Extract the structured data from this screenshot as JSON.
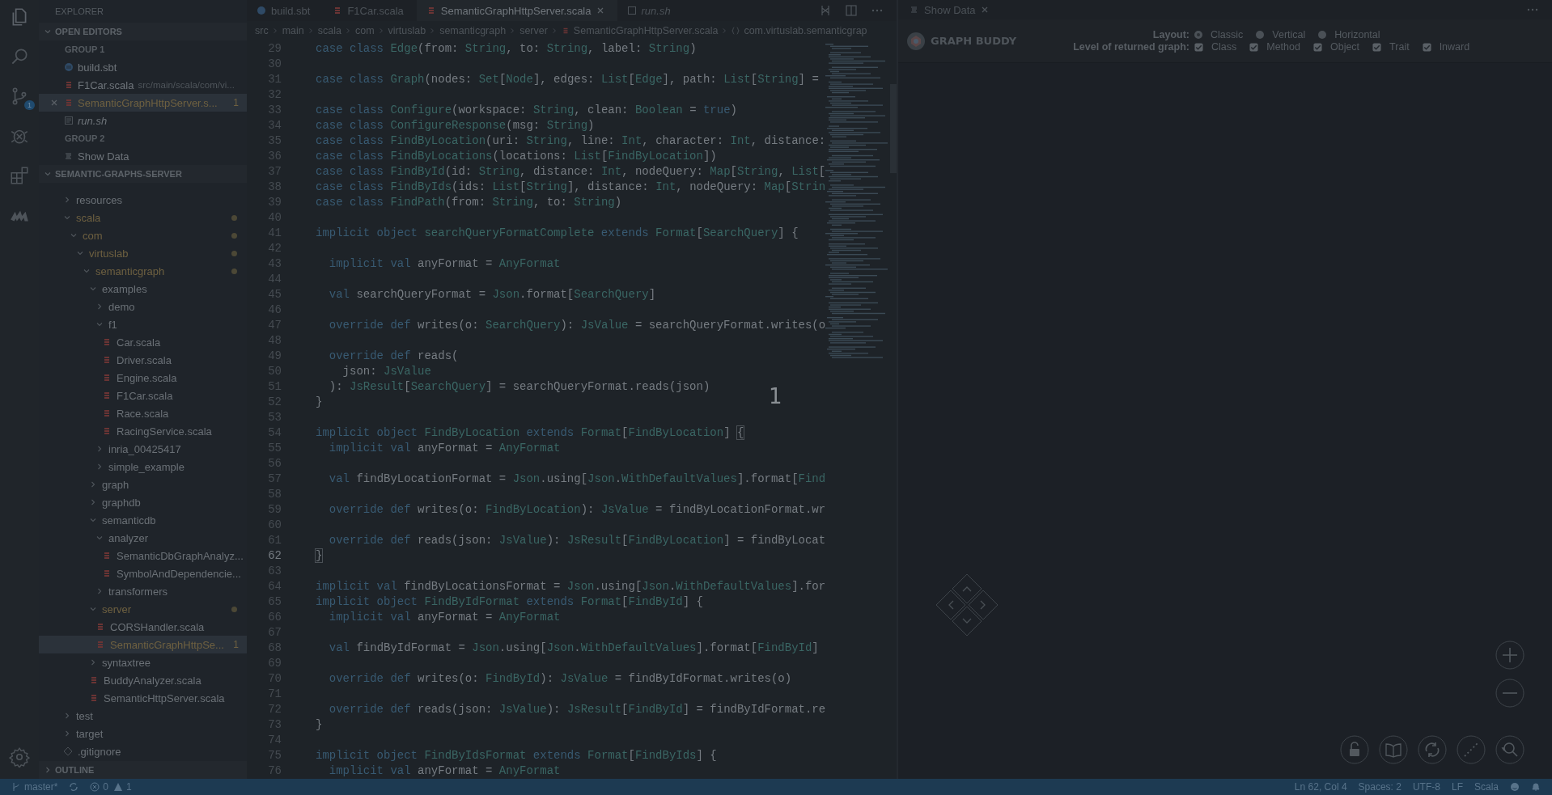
{
  "activity_bar": {
    "scm_badge": "1"
  },
  "sidebar": {
    "title": "EXPLORER",
    "open_editors": {
      "title": "OPEN EDITORS",
      "groups": [
        {
          "title": "GROUP 1",
          "items": [
            {
              "name": "build.sbt",
              "kind": "sbt",
              "selected": false,
              "italic": false,
              "modified": false
            },
            {
              "name": "F1Car.scala",
              "description": "src/main/scala/com/vi...",
              "kind": "scala",
              "selected": false,
              "italic": false,
              "modified": false
            },
            {
              "name": "SemanticGraphHttpServer.s...",
              "kind": "scala",
              "selected": true,
              "italic": false,
              "modified": true,
              "badge": "1"
            },
            {
              "name": "run.sh",
              "kind": "shell",
              "selected": false,
              "italic": true,
              "modified": false
            }
          ]
        },
        {
          "title": "GROUP 2",
          "items": [
            {
              "name": "Show Data",
              "kind": "preview",
              "selected": false,
              "italic": false,
              "modified": false
            }
          ]
        }
      ]
    },
    "folder": {
      "title": "SEMANTIC-GRAPHS-SERVER",
      "tree": [
        {
          "name": "resources",
          "kind": "folder",
          "expanded": false,
          "modified": false,
          "selected": false
        },
        {
          "name": "scala",
          "kind": "folder",
          "expanded": true,
          "modified": true,
          "selected": false,
          "children": [
            {
              "name": "com",
              "kind": "folder",
              "expanded": true,
              "modified": true,
              "selected": false,
              "children": [
                {
                  "name": "virtuslab",
                  "kind": "folder",
                  "expanded": true,
                  "modified": true,
                  "selected": false,
                  "children": [
                    {
                      "name": "semanticgraph",
                      "kind": "folder",
                      "expanded": true,
                      "modified": true,
                      "selected": false,
                      "children": [
                        {
                          "name": "examples",
                          "kind": "folder",
                          "expanded": true,
                          "modified": false,
                          "selected": false,
                          "children": [
                            {
                              "name": "demo",
                              "kind": "folder",
                              "expanded": false,
                              "modified": false,
                              "selected": false
                            },
                            {
                              "name": "f1",
                              "kind": "folder",
                              "expanded": true,
                              "modified": false,
                              "selected": false,
                              "children": [
                                {
                                  "name": "Car.scala",
                                  "kind": "scala",
                                  "modified": false,
                                  "selected": false
                                },
                                {
                                  "name": "Driver.scala",
                                  "kind": "scala",
                                  "modified": false,
                                  "selected": false
                                },
                                {
                                  "name": "Engine.scala",
                                  "kind": "scala",
                                  "modified": false,
                                  "selected": false
                                },
                                {
                                  "name": "F1Car.scala",
                                  "kind": "scala",
                                  "modified": false,
                                  "selected": false
                                },
                                {
                                  "name": "Race.scala",
                                  "kind": "scala",
                                  "modified": false,
                                  "selected": false
                                },
                                {
                                  "name": "RacingService.scala",
                                  "kind": "scala",
                                  "modified": false,
                                  "selected": false
                                }
                              ]
                            },
                            {
                              "name": "inria_00425417",
                              "kind": "folder",
                              "expanded": false,
                              "modified": false,
                              "selected": false
                            },
                            {
                              "name": "simple_example",
                              "kind": "folder",
                              "expanded": false,
                              "modified": false,
                              "selected": false
                            }
                          ]
                        },
                        {
                          "name": "graph",
                          "kind": "folder",
                          "expanded": false,
                          "modified": false,
                          "selected": false
                        },
                        {
                          "name": "graphdb",
                          "kind": "folder",
                          "expanded": false,
                          "modified": false,
                          "selected": false
                        },
                        {
                          "name": "semanticdb",
                          "kind": "folder",
                          "expanded": true,
                          "modified": false,
                          "selected": false,
                          "children": [
                            {
                              "name": "analyzer",
                              "kind": "folder",
                              "expanded": true,
                              "modified": false,
                              "selected": false,
                              "children": [
                                {
                                  "name": "SemanticDbGraphAnalyz...",
                                  "kind": "scala",
                                  "modified": false,
                                  "selected": false
                                },
                                {
                                  "name": "SymbolAndDependencie...",
                                  "kind": "scala",
                                  "modified": false,
                                  "selected": false
                                }
                              ]
                            },
                            {
                              "name": "transformers",
                              "kind": "folder",
                              "expanded": false,
                              "modified": false,
                              "selected": false
                            }
                          ]
                        },
                        {
                          "name": "server",
                          "kind": "folder",
                          "expanded": true,
                          "modified": true,
                          "selected": false,
                          "children": [
                            {
                              "name": "CORSHandler.scala",
                              "kind": "scala",
                              "modified": false,
                              "selected": false
                            },
                            {
                              "name": "SemanticGraphHttpSe...",
                              "kind": "scala",
                              "modified": true,
                              "selected": true,
                              "badge": "1"
                            }
                          ]
                        },
                        {
                          "name": "syntaxtree",
                          "kind": "folder",
                          "expanded": false,
                          "modified": false,
                          "selected": false
                        },
                        {
                          "name": "BuddyAnalyzer.scala",
                          "kind": "scala",
                          "modified": false,
                          "selected": false
                        },
                        {
                          "name": "SemanticHttpServer.scala",
                          "kind": "scala",
                          "modified": false,
                          "selected": false
                        }
                      ]
                    }
                  ]
                }
              ]
            }
          ]
        },
        {
          "name": "test",
          "kind": "folder",
          "expanded": false,
          "modified": false,
          "selected": false
        },
        {
          "name": "target",
          "kind": "folder",
          "expanded": false,
          "modified": false,
          "selected": false
        },
        {
          "name": ".gitignore",
          "kind": "git",
          "modified": false,
          "selected": false
        }
      ]
    },
    "outline": {
      "title": "OUTLINE"
    }
  },
  "editor": {
    "tabs": [
      {
        "label": "build.sbt",
        "kind": "sbt",
        "selected": false,
        "italic": false
      },
      {
        "label": "F1Car.scala",
        "kind": "scala",
        "selected": false,
        "italic": false
      },
      {
        "label": "SemanticGraphHttpServer.scala",
        "kind": "scala",
        "selected": true,
        "italic": false
      },
      {
        "label": "run.sh",
        "kind": "shell",
        "selected": false,
        "italic": true
      }
    ],
    "breadcrumbs": [
      {
        "label": "src",
        "kind": "folder"
      },
      {
        "label": "main",
        "kind": "folder"
      },
      {
        "label": "scala",
        "kind": "folder"
      },
      {
        "label": "com",
        "kind": "folder"
      },
      {
        "label": "virtuslab",
        "kind": "folder"
      },
      {
        "label": "semanticgraph",
        "kind": "folder"
      },
      {
        "label": "server",
        "kind": "folder"
      },
      {
        "label": "SemanticGraphHttpServer.scala",
        "kind": "file"
      },
      {
        "label": "com.virtuslab.semanticgrap",
        "kind": "package"
      }
    ],
    "lines": [
      {
        "n": "29",
        "tokens": [
          {
            "text": "case class ",
            "kind": "keyword"
          },
          {
            "text": "Edge",
            "kind": "type"
          },
          {
            "text": "(from: ",
            "kind": "plain"
          },
          {
            "text": "String",
            "kind": "type"
          },
          {
            "text": ", to: ",
            "kind": "plain"
          },
          {
            "text": "String",
            "kind": "type"
          },
          {
            "text": ", label: ",
            "kind": "plain"
          },
          {
            "text": "String",
            "kind": "type"
          },
          {
            "text": ")",
            "kind": "plain"
          }
        ]
      },
      {
        "n": "30"
      },
      {
        "n": "31",
        "tokens": [
          {
            "text": "case class ",
            "kind": "keyword"
          },
          {
            "text": "Graph",
            "kind": "type"
          },
          {
            "text": "(nodes: ",
            "kind": "plain"
          },
          {
            "text": "Set",
            "kind": "type"
          },
          {
            "text": "[",
            "kind": "plain"
          },
          {
            "text": "Node",
            "kind": "type"
          },
          {
            "text": "], edges: ",
            "kind": "plain"
          },
          {
            "text": "List",
            "kind": "type"
          },
          {
            "text": "[",
            "kind": "plain"
          },
          {
            "text": "Edge",
            "kind": "type"
          },
          {
            "text": "], path: ",
            "kind": "plain"
          },
          {
            "text": "List",
            "kind": "type"
          },
          {
            "text": "[",
            "kind": "plain"
          },
          {
            "text": "String",
            "kind": "type"
          },
          {
            "text": "] =",
            "kind": "plain"
          }
        ]
      },
      {
        "n": "32"
      },
      {
        "n": "33",
        "tokens": [
          {
            "text": "case class ",
            "kind": "keyword"
          },
          {
            "text": "Configure",
            "kind": "type"
          },
          {
            "text": "(workspace: ",
            "kind": "plain"
          },
          {
            "text": "String",
            "kind": "type"
          },
          {
            "text": ", clean: ",
            "kind": "plain"
          },
          {
            "text": "Boolean",
            "kind": "type"
          },
          {
            "text": " = ",
            "kind": "plain"
          },
          {
            "text": "true",
            "kind": "keyword"
          },
          {
            "text": ")",
            "kind": "plain"
          }
        ]
      },
      {
        "n": "34",
        "tokens": [
          {
            "text": "case class ",
            "kind": "keyword"
          },
          {
            "text": "ConfigureResponse",
            "kind": "type"
          },
          {
            "text": "(msg: ",
            "kind": "plain"
          },
          {
            "text": "String",
            "kind": "type"
          },
          {
            "text": ")",
            "kind": "plain"
          }
        ]
      },
      {
        "n": "35",
        "tokens": [
          {
            "text": "case class ",
            "kind": "keyword"
          },
          {
            "text": "FindByLocation",
            "kind": "type"
          },
          {
            "text": "(uri: ",
            "kind": "plain"
          },
          {
            "text": "String",
            "kind": "type"
          },
          {
            "text": ", line: ",
            "kind": "plain"
          },
          {
            "text": "Int",
            "kind": "type"
          },
          {
            "text": ", character: ",
            "kind": "plain"
          },
          {
            "text": "Int",
            "kind": "type"
          },
          {
            "text": ", distance:",
            "kind": "plain"
          }
        ]
      },
      {
        "n": "36",
        "tokens": [
          {
            "text": "case class ",
            "kind": "keyword"
          },
          {
            "text": "FindByLocations",
            "kind": "type"
          },
          {
            "text": "(locations: ",
            "kind": "plain"
          },
          {
            "text": "List",
            "kind": "type"
          },
          {
            "text": "[",
            "kind": "plain"
          },
          {
            "text": "FindByLocation",
            "kind": "type"
          },
          {
            "text": "])",
            "kind": "plain"
          }
        ]
      },
      {
        "n": "37",
        "tokens": [
          {
            "text": "case class ",
            "kind": "keyword"
          },
          {
            "text": "FindById",
            "kind": "type"
          },
          {
            "text": "(id: ",
            "kind": "plain"
          },
          {
            "text": "String",
            "kind": "type"
          },
          {
            "text": ", distance: ",
            "kind": "plain"
          },
          {
            "text": "Int",
            "kind": "type"
          },
          {
            "text": ", nodeQuery: ",
            "kind": "plain"
          },
          {
            "text": "Map",
            "kind": "type"
          },
          {
            "text": "[",
            "kind": "plain"
          },
          {
            "text": "String",
            "kind": "type"
          },
          {
            "text": ", ",
            "kind": "plain"
          },
          {
            "text": "List",
            "kind": "type"
          },
          {
            "text": "[",
            "kind": "plain"
          }
        ]
      },
      {
        "n": "38",
        "tokens": [
          {
            "text": "case class ",
            "kind": "keyword"
          },
          {
            "text": "FindByIds",
            "kind": "type"
          },
          {
            "text": "(ids: ",
            "kind": "plain"
          },
          {
            "text": "List",
            "kind": "type"
          },
          {
            "text": "[",
            "kind": "plain"
          },
          {
            "text": "String",
            "kind": "type"
          },
          {
            "text": "], distance: ",
            "kind": "plain"
          },
          {
            "text": "Int",
            "kind": "type"
          },
          {
            "text": ", nodeQuery: ",
            "kind": "plain"
          },
          {
            "text": "Map",
            "kind": "type"
          },
          {
            "text": "[",
            "kind": "plain"
          },
          {
            "text": "Strin",
            "kind": "type"
          }
        ]
      },
      {
        "n": "39",
        "tokens": [
          {
            "text": "case class ",
            "kind": "keyword"
          },
          {
            "text": "FindPath",
            "kind": "type"
          },
          {
            "text": "(from: ",
            "kind": "plain"
          },
          {
            "text": "String",
            "kind": "type"
          },
          {
            "text": ", to: ",
            "kind": "plain"
          },
          {
            "text": "String",
            "kind": "type"
          },
          {
            "text": ")",
            "kind": "plain"
          }
        ]
      },
      {
        "n": "40"
      },
      {
        "n": "41",
        "tokens": [
          {
            "text": "implicit object ",
            "kind": "keyword"
          },
          {
            "text": "searchQueryFormatComplete",
            "kind": "type"
          },
          {
            "text": " extends ",
            "kind": "keyword"
          },
          {
            "text": "Format",
            "kind": "type"
          },
          {
            "text": "[",
            "kind": "plain"
          },
          {
            "text": "SearchQuery",
            "kind": "type"
          },
          {
            "text": "] {",
            "kind": "plain"
          }
        ]
      },
      {
        "n": "42"
      },
      {
        "n": "43",
        "tokens": [
          {
            "text": "  implicit val ",
            "kind": "keyword"
          },
          {
            "text": "anyFormat = ",
            "kind": "plain"
          },
          {
            "text": "AnyFormat",
            "kind": "type"
          }
        ]
      },
      {
        "n": "44"
      },
      {
        "n": "45",
        "tokens": [
          {
            "text": "  val ",
            "kind": "keyword"
          },
          {
            "text": "searchQueryFormat = ",
            "kind": "plain"
          },
          {
            "text": "Json",
            "kind": "type"
          },
          {
            "text": ".format[",
            "kind": "plain"
          },
          {
            "text": "SearchQuery",
            "kind": "type"
          },
          {
            "text": "]",
            "kind": "plain"
          }
        ]
      },
      {
        "n": "46"
      },
      {
        "n": "47",
        "tokens": [
          {
            "text": "  override def ",
            "kind": "keyword"
          },
          {
            "text": "writes(o: ",
            "kind": "plain"
          },
          {
            "text": "SearchQuery",
            "kind": "type"
          },
          {
            "text": "): ",
            "kind": "plain"
          },
          {
            "text": "JsValue",
            "kind": "type"
          },
          {
            "text": " = searchQueryFormat.writes(o",
            "kind": "plain"
          }
        ]
      },
      {
        "n": "48"
      },
      {
        "n": "49",
        "tokens": [
          {
            "text": "  override def ",
            "kind": "keyword"
          },
          {
            "text": "reads(",
            "kind": "plain"
          }
        ]
      },
      {
        "n": "50",
        "tokens": [
          {
            "text": "    json: ",
            "kind": "plain"
          },
          {
            "text": "JsValue",
            "kind": "type"
          }
        ]
      },
      {
        "n": "51",
        "tokens": [
          {
            "text": "  ): ",
            "kind": "plain"
          },
          {
            "text": "JsResult",
            "kind": "type"
          },
          {
            "text": "[",
            "kind": "plain"
          },
          {
            "text": "SearchQuery",
            "kind": "type"
          },
          {
            "text": "] = searchQueryFormat.reads(json)",
            "kind": "plain"
          }
        ]
      },
      {
        "n": "52",
        "tokens": [
          {
            "text": "}",
            "kind": "plain"
          }
        ]
      },
      {
        "n": "53"
      },
      {
        "n": "54",
        "tokens": [
          {
            "text": "implicit object ",
            "kind": "keyword"
          },
          {
            "text": "FindByLocation",
            "kind": "type"
          },
          {
            "text": " extends ",
            "kind": "keyword"
          },
          {
            "text": "Format",
            "kind": "type"
          },
          {
            "text": "[",
            "kind": "plain"
          },
          {
            "text": "FindByLocation",
            "kind": "type"
          },
          {
            "text": "] ",
            "kind": "plain"
          },
          {
            "text": "{",
            "kind": "bracket"
          }
        ]
      },
      {
        "n": "55",
        "tokens": [
          {
            "text": "  implicit val ",
            "kind": "keyword"
          },
          {
            "text": "anyFormat = ",
            "kind": "plain"
          },
          {
            "text": "AnyFormat",
            "kind": "type"
          }
        ]
      },
      {
        "n": "56"
      },
      {
        "n": "57",
        "tokens": [
          {
            "text": "  val ",
            "kind": "keyword"
          },
          {
            "text": "findByLocationFormat = ",
            "kind": "plain"
          },
          {
            "text": "Json",
            "kind": "type"
          },
          {
            "text": ".using[",
            "kind": "plain"
          },
          {
            "text": "Json",
            "kind": "type"
          },
          {
            "text": ".",
            "kind": "plain"
          },
          {
            "text": "WithDefaultValues",
            "kind": "type"
          },
          {
            "text": "].format[",
            "kind": "plain"
          },
          {
            "text": "Find",
            "kind": "type"
          }
        ]
      },
      {
        "n": "58"
      },
      {
        "n": "59",
        "tokens": [
          {
            "text": "  override def ",
            "kind": "keyword"
          },
          {
            "text": "writes(o: ",
            "kind": "plain"
          },
          {
            "text": "FindByLocation",
            "kind": "type"
          },
          {
            "text": "): ",
            "kind": "plain"
          },
          {
            "text": "JsValue",
            "kind": "type"
          },
          {
            "text": " = findByLocationFormat.wr",
            "kind": "plain"
          }
        ]
      },
      {
        "n": "60"
      },
      {
        "n": "61",
        "tokens": [
          {
            "text": "  override def ",
            "kind": "keyword"
          },
          {
            "text": "reads(json: ",
            "kind": "plain"
          },
          {
            "text": "JsValue",
            "kind": "type"
          },
          {
            "text": "): ",
            "kind": "plain"
          },
          {
            "text": "JsResult",
            "kind": "type"
          },
          {
            "text": "[",
            "kind": "plain"
          },
          {
            "text": "FindByLocation",
            "kind": "type"
          },
          {
            "text": "] = findByLocat",
            "kind": "plain"
          }
        ]
      },
      {
        "n": "62",
        "current": true,
        "tokens": [
          {
            "text": "}",
            "kind": "bracket"
          }
        ]
      },
      {
        "n": "63"
      },
      {
        "n": "64",
        "tokens": [
          {
            "text": "implicit val ",
            "kind": "keyword"
          },
          {
            "text": "findByLocationsFormat = ",
            "kind": "plain"
          },
          {
            "text": "Json",
            "kind": "type"
          },
          {
            "text": ".using[",
            "kind": "plain"
          },
          {
            "text": "Json",
            "kind": "type"
          },
          {
            "text": ".",
            "kind": "plain"
          },
          {
            "text": "WithDefaultValues",
            "kind": "type"
          },
          {
            "text": "].for",
            "kind": "plain"
          }
        ]
      },
      {
        "n": "65",
        "tokens": [
          {
            "text": "implicit object ",
            "kind": "keyword"
          },
          {
            "text": "FindByIdFormat",
            "kind": "type"
          },
          {
            "text": " extends ",
            "kind": "keyword"
          },
          {
            "text": "Format",
            "kind": "type"
          },
          {
            "text": "[",
            "kind": "plain"
          },
          {
            "text": "FindById",
            "kind": "type"
          },
          {
            "text": "] {",
            "kind": "plain"
          }
        ]
      },
      {
        "n": "66",
        "tokens": [
          {
            "text": "  implicit val ",
            "kind": "keyword"
          },
          {
            "text": "anyFormat = ",
            "kind": "plain"
          },
          {
            "text": "AnyFormat",
            "kind": "type"
          }
        ]
      },
      {
        "n": "67"
      },
      {
        "n": "68",
        "tokens": [
          {
            "text": "  val ",
            "kind": "keyword"
          },
          {
            "text": "findByIdFormat = ",
            "kind": "plain"
          },
          {
            "text": "Json",
            "kind": "type"
          },
          {
            "text": ".using[",
            "kind": "plain"
          },
          {
            "text": "Json",
            "kind": "type"
          },
          {
            "text": ".",
            "kind": "plain"
          },
          {
            "text": "WithDefaultValues",
            "kind": "type"
          },
          {
            "text": "].format[",
            "kind": "plain"
          },
          {
            "text": "FindById",
            "kind": "type"
          },
          {
            "text": "]",
            "kind": "plain"
          }
        ]
      },
      {
        "n": "69"
      },
      {
        "n": "70",
        "tokens": [
          {
            "text": "  override def ",
            "kind": "keyword"
          },
          {
            "text": "writes(o: ",
            "kind": "plain"
          },
          {
            "text": "FindById",
            "kind": "type"
          },
          {
            "text": "): ",
            "kind": "plain"
          },
          {
            "text": "JsValue",
            "kind": "type"
          },
          {
            "text": " = findByIdFormat.writes(o)",
            "kind": "plain"
          }
        ]
      },
      {
        "n": "71"
      },
      {
        "n": "72",
        "tokens": [
          {
            "text": "  override def ",
            "kind": "keyword"
          },
          {
            "text": "reads(json: ",
            "kind": "plain"
          },
          {
            "text": "JsValue",
            "kind": "type"
          },
          {
            "text": "): ",
            "kind": "plain"
          },
          {
            "text": "JsResult",
            "kind": "type"
          },
          {
            "text": "[",
            "kind": "plain"
          },
          {
            "text": "FindById",
            "kind": "type"
          },
          {
            "text": "] = findByIdFormat.re",
            "kind": "plain"
          }
        ]
      },
      {
        "n": "73",
        "tokens": [
          {
            "text": "}",
            "kind": "plain"
          }
        ]
      },
      {
        "n": "74"
      },
      {
        "n": "75",
        "tokens": [
          {
            "text": "implicit object ",
            "kind": "keyword"
          },
          {
            "text": "FindByIdsFormat",
            "kind": "type"
          },
          {
            "text": " extends ",
            "kind": "keyword"
          },
          {
            "text": "Format",
            "kind": "type"
          },
          {
            "text": "[",
            "kind": "plain"
          },
          {
            "text": "FindByIds",
            "kind": "type"
          },
          {
            "text": "] {",
            "kind": "plain"
          }
        ]
      },
      {
        "n": "76",
        "tokens": [
          {
            "text": "  implicit val ",
            "kind": "keyword"
          },
          {
            "text": "anyFormat = ",
            "kind": "plain"
          },
          {
            "text": "AnyFormat",
            "kind": "type"
          }
        ]
      }
    ],
    "overlay_digit": "1"
  },
  "graph_panel": {
    "tab": "Show Data",
    "brand": "GRAPH BUDDY",
    "layout": {
      "label": "Layout:",
      "options": [
        {
          "label": "Classic",
          "selected": true
        },
        {
          "label": "Vertical",
          "selected": false
        },
        {
          "label": "Horizontal",
          "selected": false
        }
      ]
    },
    "levels": {
      "label": "Level of returned graph:",
      "options": [
        {
          "label": "Class",
          "checked": true
        },
        {
          "label": "Method",
          "checked": true
        },
        {
          "label": "Object",
          "checked": true
        },
        {
          "label": "Trait",
          "checked": true
        },
        {
          "label": "Inward",
          "checked": true
        }
      ]
    }
  },
  "status_bar": {
    "branch": "master*",
    "errors": "0",
    "warnings": "1",
    "position": "Ln 62, Col 4",
    "indent": "Spaces: 2",
    "encoding": "UTF-8",
    "eol": "LF",
    "language": "Scala"
  }
}
